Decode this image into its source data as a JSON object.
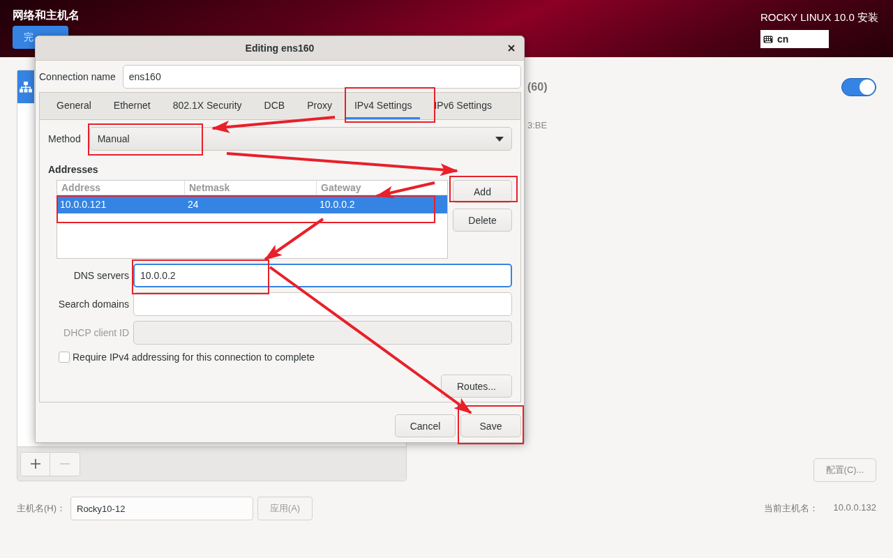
{
  "header": {
    "title": "网络和主机名",
    "done_button": "完",
    "product": "ROCKY LINUX 10.0 安装",
    "keyboard_layout": "cn"
  },
  "device": {
    "name": "(60)",
    "hardware_address": "3:BE",
    "enabled": true,
    "configure_button": "配置(C)..."
  },
  "hostname": {
    "label": "主机名(H)：",
    "value": "Rocky10-12",
    "apply_button": {
      "label": "应用(A)",
      "disabled": true
    },
    "current_label": "当前主机名：",
    "current_value": "10.0.0.132"
  },
  "dialog": {
    "title": "Editing ens160",
    "connection_name_label": "Connection name",
    "connection_name": "ens160",
    "tabs": [
      {
        "label": "General",
        "selected": false
      },
      {
        "label": "Ethernet",
        "selected": false
      },
      {
        "label": "802.1X Security",
        "selected": false
      },
      {
        "label": "DCB",
        "selected": false
      },
      {
        "label": "Proxy",
        "selected": false
      },
      {
        "label": "IPv4 Settings",
        "selected": true
      },
      {
        "label": "IPv6 Settings",
        "selected": false
      }
    ],
    "method_label": "Method",
    "method": "Manual",
    "addresses_title": "Addresses",
    "columns": [
      "Address",
      "Netmask",
      "Gateway"
    ],
    "rows": [
      {
        "address": "10.0.0.121",
        "netmask": "24",
        "gateway": "10.0.0.2",
        "selected": true
      }
    ],
    "add_button": "Add",
    "delete_button": "Delete",
    "fields": [
      {
        "label": "DNS servers",
        "value": "10.0.0.2",
        "focused": true,
        "disabled": false
      },
      {
        "label": "Search domains",
        "focused": false,
        "disabled": false
      },
      {
        "label": "DHCP client ID",
        "focused": false,
        "disabled": true
      }
    ],
    "require_checkbox": {
      "label": "Require IPv4 addressing for this connection to complete",
      "checked": false
    },
    "routes_button": "Routes...",
    "cancel_button": "Cancel",
    "save_button": "Save"
  }
}
